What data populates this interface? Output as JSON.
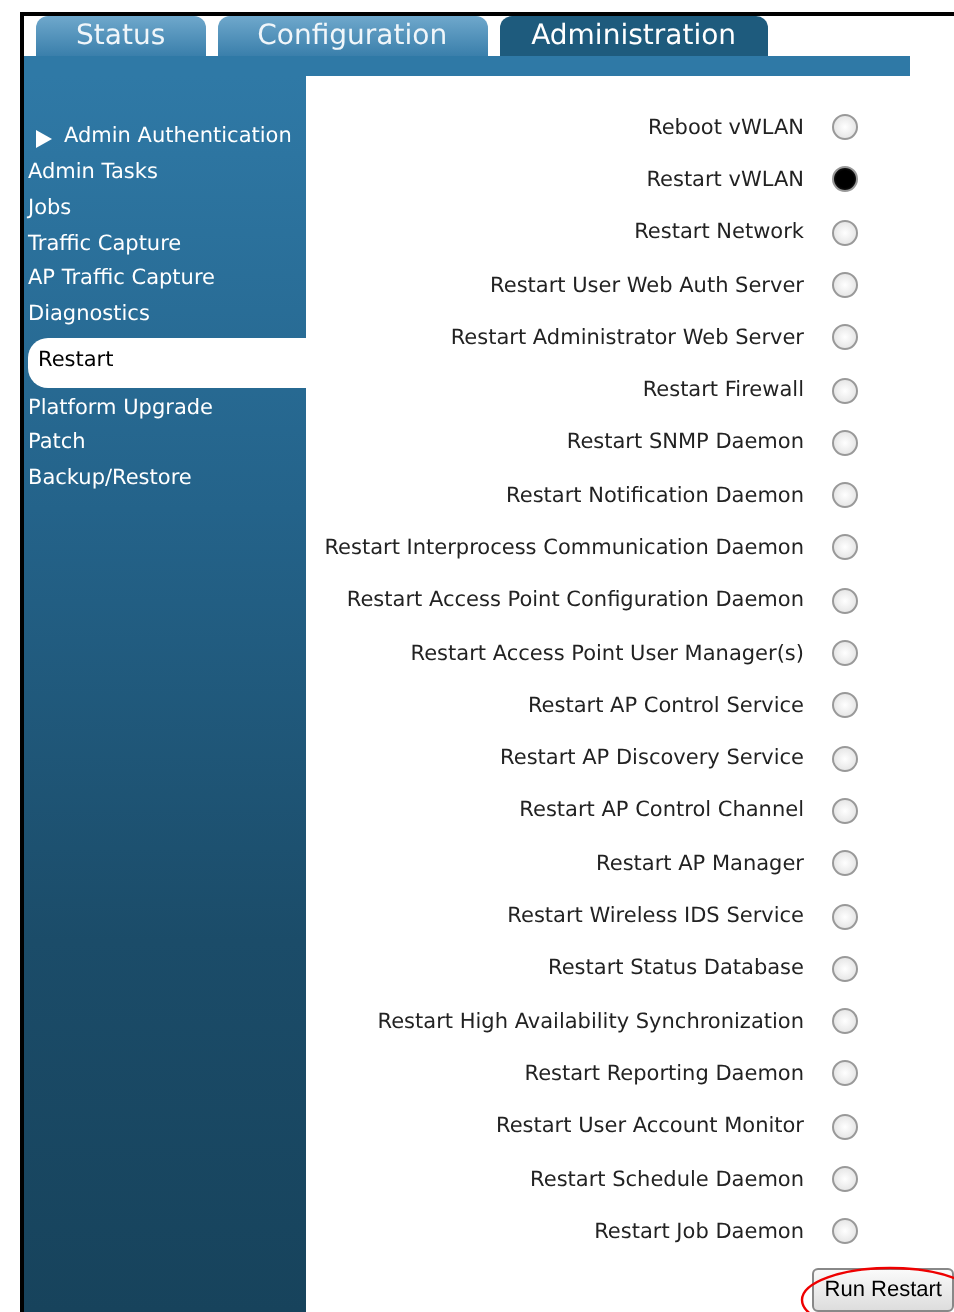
{
  "tabs": [
    {
      "label": "Status",
      "selected": false
    },
    {
      "label": "Configuration",
      "selected": false
    },
    {
      "label": "Administration",
      "selected": true
    }
  ],
  "sidebar": {
    "items": [
      {
        "label": "Admin Authentication",
        "kind": "header",
        "selected": false
      },
      {
        "label": "Admin Tasks",
        "kind": "link",
        "selected": false
      },
      {
        "label": "Jobs",
        "kind": "link",
        "selected": false
      },
      {
        "label": "Traffic Capture",
        "kind": "link",
        "selected": false
      },
      {
        "label": "AP Traffic Capture",
        "kind": "link",
        "selected": false
      },
      {
        "label": "Diagnostics",
        "kind": "link",
        "selected": false
      },
      {
        "label": "Restart",
        "kind": "link",
        "selected": true
      },
      {
        "label": "Platform Upgrade",
        "kind": "link",
        "selected": false
      },
      {
        "label": "Patch",
        "kind": "link",
        "selected": false
      },
      {
        "label": "Backup/Restore",
        "kind": "link",
        "selected": false
      }
    ]
  },
  "options": [
    {
      "label": "Reboot vWLAN",
      "selected": false
    },
    {
      "label": "Restart vWLAN",
      "selected": true
    },
    {
      "label": "Restart Network",
      "selected": false
    },
    {
      "label": "Restart User Web Auth Server",
      "selected": false
    },
    {
      "label": "Restart Administrator Web Server",
      "selected": false
    },
    {
      "label": "Restart Firewall",
      "selected": false
    },
    {
      "label": "Restart SNMP Daemon",
      "selected": false
    },
    {
      "label": "Restart Notification Daemon",
      "selected": false
    },
    {
      "label": "Restart Interprocess Communication Daemon",
      "selected": false
    },
    {
      "label": "Restart Access Point Configuration Daemon",
      "selected": false
    },
    {
      "label": "Restart Access Point User Manager(s)",
      "selected": false
    },
    {
      "label": "Restart AP Control Service",
      "selected": false
    },
    {
      "label": "Restart AP Discovery Service",
      "selected": false
    },
    {
      "label": "Restart AP Control Channel",
      "selected": false
    },
    {
      "label": "Restart AP Manager",
      "selected": false
    },
    {
      "label": "Restart Wireless IDS Service",
      "selected": false
    },
    {
      "label": "Restart Status Database",
      "selected": false
    },
    {
      "label": "Restart High Availability Synchronization",
      "selected": false
    },
    {
      "label": "Restart Reporting Daemon",
      "selected": false
    },
    {
      "label": "Restart User Account Monitor",
      "selected": false
    },
    {
      "label": "Restart Schedule Daemon",
      "selected": false
    },
    {
      "label": "Restart Job Daemon",
      "selected": false
    }
  ],
  "button": {
    "label": "Run Restart"
  }
}
